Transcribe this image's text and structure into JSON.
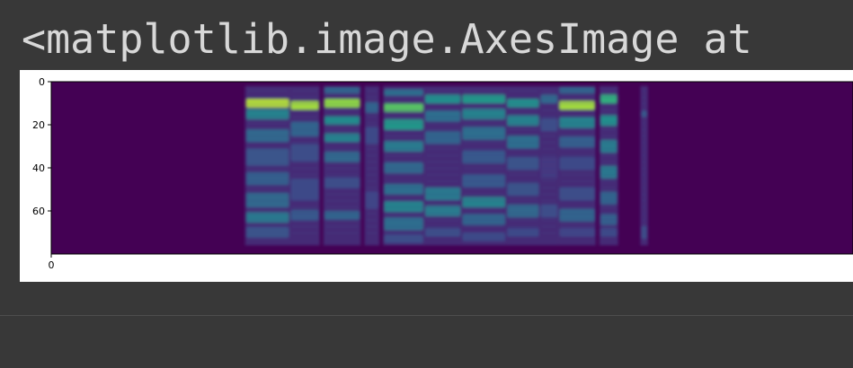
{
  "notebook_output": {
    "repr_text": "<matplotlib.image.AxesImage at"
  },
  "chart_data": {
    "type": "heatmap",
    "title": "",
    "xlabel": "",
    "ylabel": "",
    "colormap": "viridis",
    "background_color": "#440154",
    "x_ticks": [
      "0"
    ],
    "y_ticks": [
      "0",
      "20",
      "40",
      "60"
    ],
    "y_range": [
      0,
      80
    ],
    "x_range_visible": [
      0,
      430
    ],
    "grid": false,
    "segments": [
      {
        "x_start": 104,
        "x_end": 128,
        "bands": [
          [
            10,
            4,
            0.92
          ],
          [
            15,
            5,
            0.55
          ],
          [
            25,
            6,
            0.42
          ],
          [
            35,
            8,
            0.33
          ],
          [
            45,
            6,
            0.38
          ],
          [
            55,
            7,
            0.42
          ],
          [
            63,
            5,
            0.5
          ],
          [
            70,
            5,
            0.32
          ]
        ]
      },
      {
        "x_start": 128,
        "x_end": 144,
        "bands": [
          [
            11,
            4,
            0.9
          ],
          [
            22,
            7,
            0.4
          ],
          [
            33,
            8,
            0.3
          ],
          [
            50,
            10,
            0.28
          ],
          [
            62,
            5,
            0.35
          ]
        ]
      },
      {
        "x_start": 146,
        "x_end": 166,
        "bands": [
          [
            4,
            3,
            0.4
          ],
          [
            10,
            4,
            0.88
          ],
          [
            18,
            4,
            0.6
          ],
          [
            26,
            4,
            0.55
          ],
          [
            35,
            5,
            0.42
          ],
          [
            47,
            5,
            0.3
          ],
          [
            62,
            4,
            0.4
          ]
        ]
      },
      {
        "x_start": 168,
        "x_end": 176,
        "bands": [
          [
            12,
            5,
            0.4
          ],
          [
            25,
            8,
            0.28
          ],
          [
            55,
            8,
            0.25
          ]
        ]
      },
      {
        "x_start": 178,
        "x_end": 200,
        "bands": [
          [
            5,
            3,
            0.45
          ],
          [
            12,
            4,
            0.8
          ],
          [
            20,
            5,
            0.65
          ],
          [
            30,
            5,
            0.52
          ],
          [
            40,
            5,
            0.42
          ],
          [
            50,
            5,
            0.45
          ],
          [
            58,
            5,
            0.55
          ],
          [
            66,
            6,
            0.45
          ],
          [
            73,
            4,
            0.3
          ]
        ]
      },
      {
        "x_start": 200,
        "x_end": 220,
        "bands": [
          [
            8,
            4,
            0.62
          ],
          [
            16,
            5,
            0.45
          ],
          [
            26,
            6,
            0.4
          ],
          [
            52,
            6,
            0.5
          ],
          [
            60,
            5,
            0.52
          ],
          [
            70,
            4,
            0.3
          ]
        ]
      },
      {
        "x_start": 220,
        "x_end": 244,
        "bands": [
          [
            8,
            4,
            0.65
          ],
          [
            15,
            5,
            0.55
          ],
          [
            24,
            6,
            0.45
          ],
          [
            35,
            6,
            0.35
          ],
          [
            46,
            6,
            0.35
          ],
          [
            56,
            5,
            0.55
          ],
          [
            64,
            5,
            0.4
          ],
          [
            72,
            4,
            0.28
          ]
        ]
      },
      {
        "x_start": 244,
        "x_end": 262,
        "bands": [
          [
            10,
            4,
            0.62
          ],
          [
            18,
            5,
            0.55
          ],
          [
            28,
            6,
            0.45
          ],
          [
            38,
            6,
            0.32
          ],
          [
            50,
            6,
            0.32
          ],
          [
            60,
            6,
            0.42
          ],
          [
            70,
            4,
            0.28
          ]
        ]
      },
      {
        "x_start": 262,
        "x_end": 272,
        "bands": [
          [
            8,
            4,
            0.42
          ],
          [
            20,
            6,
            0.3
          ],
          [
            40,
            10,
            0.2
          ],
          [
            60,
            6,
            0.3
          ]
        ]
      },
      {
        "x_start": 272,
        "x_end": 292,
        "bands": [
          [
            4,
            3,
            0.4
          ],
          [
            11,
            4,
            0.9
          ],
          [
            19,
            5,
            0.55
          ],
          [
            28,
            5,
            0.38
          ],
          [
            38,
            6,
            0.28
          ],
          [
            52,
            6,
            0.3
          ],
          [
            62,
            6,
            0.4
          ],
          [
            70,
            4,
            0.25
          ]
        ]
      },
      {
        "x_start": 294,
        "x_end": 304,
        "bands": [
          [
            8,
            4,
            0.72
          ],
          [
            18,
            5,
            0.62
          ],
          [
            30,
            6,
            0.52
          ],
          [
            42,
            6,
            0.5
          ],
          [
            54,
            6,
            0.4
          ],
          [
            64,
            5,
            0.38
          ],
          [
            70,
            4,
            0.28
          ]
        ]
      },
      {
        "x_start": 316,
        "x_end": 320,
        "bands": [
          [
            15,
            3,
            0.35
          ],
          [
            70,
            6,
            0.3
          ]
        ]
      }
    ]
  }
}
